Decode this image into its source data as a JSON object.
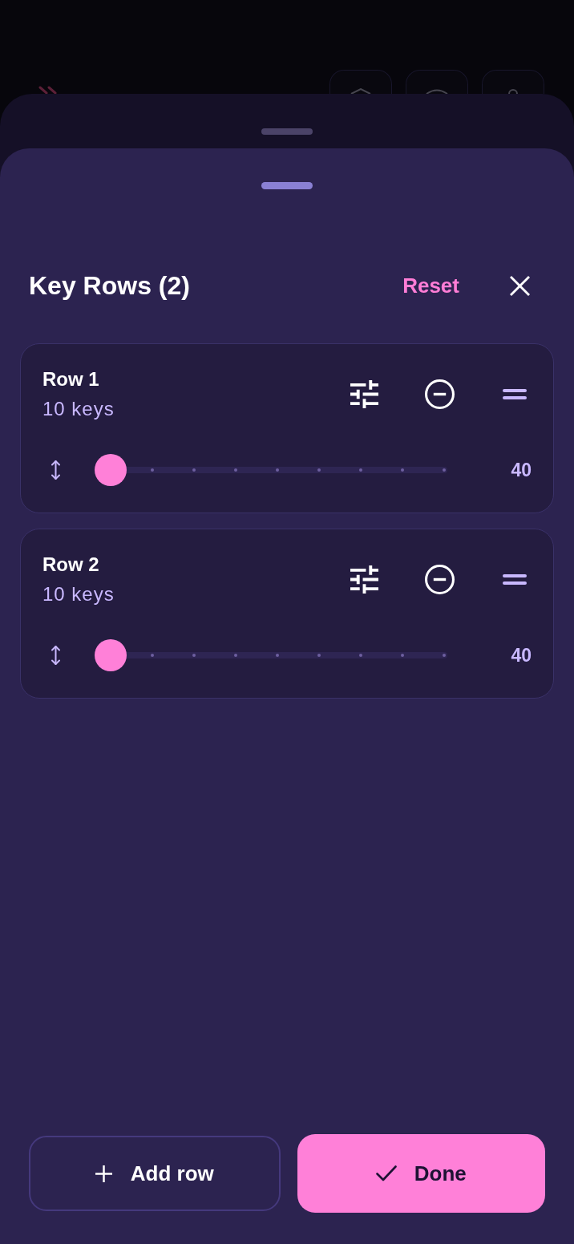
{
  "sheet": {
    "title": "Key Rows (2)",
    "reset": "Reset"
  },
  "rows": [
    {
      "name": "Row 1",
      "keys": "10 keys",
      "level": 0,
      "value": "40"
    },
    {
      "name": "Row 2",
      "keys": "10 keys",
      "level": 0,
      "value": "40"
    }
  ],
  "buttons": [
    {
      "kind": "secondary",
      "label": "Add row"
    },
    {
      "kind": "primary",
      "label": "Done"
    }
  ]
}
